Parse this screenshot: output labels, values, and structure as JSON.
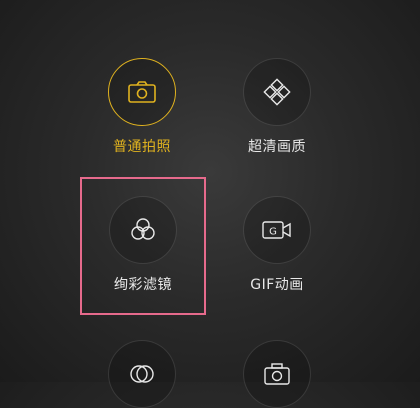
{
  "accent_color": "#e0b21f",
  "highlight_color": "#e66a8c",
  "modes": [
    {
      "label": "普通拍照",
      "icon": "camera-icon",
      "active": true
    },
    {
      "label": "超清画质",
      "icon": "diamond-grid-icon",
      "active": false
    },
    {
      "label": "绚彩滤镜",
      "icon": "color-filter-icon",
      "active": false
    },
    {
      "label": "GIF动画",
      "icon": "gif-video-icon",
      "active": false
    },
    {
      "label": "",
      "icon": "overlap-circles-icon",
      "active": false
    },
    {
      "label": "",
      "icon": "camera-outline-icon",
      "active": false
    }
  ]
}
